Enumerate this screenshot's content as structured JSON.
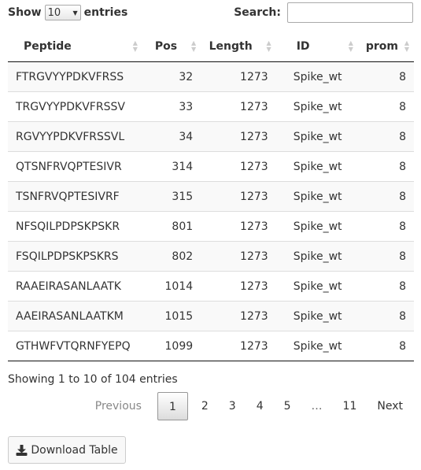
{
  "length_menu": {
    "show_label": "Show",
    "value": "10",
    "entries_label": "entries"
  },
  "search": {
    "label": "Search:",
    "value": ""
  },
  "table": {
    "columns": [
      "Peptide",
      "Pos",
      "Length",
      "ID",
      "prom"
    ],
    "rows": [
      [
        "FTRGVYYPDKVFRSS",
        "32",
        "1273",
        "Spike_wt",
        "8"
      ],
      [
        "TRGVYYPDKVFRSSV",
        "33",
        "1273",
        "Spike_wt",
        "8"
      ],
      [
        "RGVYYPDKVFRSSVL",
        "34",
        "1273",
        "Spike_wt",
        "8"
      ],
      [
        "QTSNFRVQPTESIVR",
        "314",
        "1273",
        "Spike_wt",
        "8"
      ],
      [
        "TSNFRVQPTESIVRF",
        "315",
        "1273",
        "Spike_wt",
        "8"
      ],
      [
        "NFSQILPDPSKPSKR",
        "801",
        "1273",
        "Spike_wt",
        "8"
      ],
      [
        "FSQILPDPSKPSKRS",
        "802",
        "1273",
        "Spike_wt",
        "8"
      ],
      [
        "RAAEIRASANLAATK",
        "1014",
        "1273",
        "Spike_wt",
        "8"
      ],
      [
        "AAEIRASANLAATKM",
        "1015",
        "1273",
        "Spike_wt",
        "8"
      ],
      [
        "GTHWFVTQRNFYEPQ",
        "1099",
        "1273",
        "Spike_wt",
        "8"
      ]
    ]
  },
  "info": "Showing 1 to 10 of 104 entries",
  "pagination": {
    "previous": "Previous",
    "pages": [
      "1",
      "2",
      "3",
      "4",
      "5",
      "…",
      "11"
    ],
    "next": "Next"
  },
  "download_label": "Download Table",
  "icons": {
    "download": "download-icon",
    "sort": "sort-both-icon",
    "select_arrow": "caret-down-icon"
  }
}
